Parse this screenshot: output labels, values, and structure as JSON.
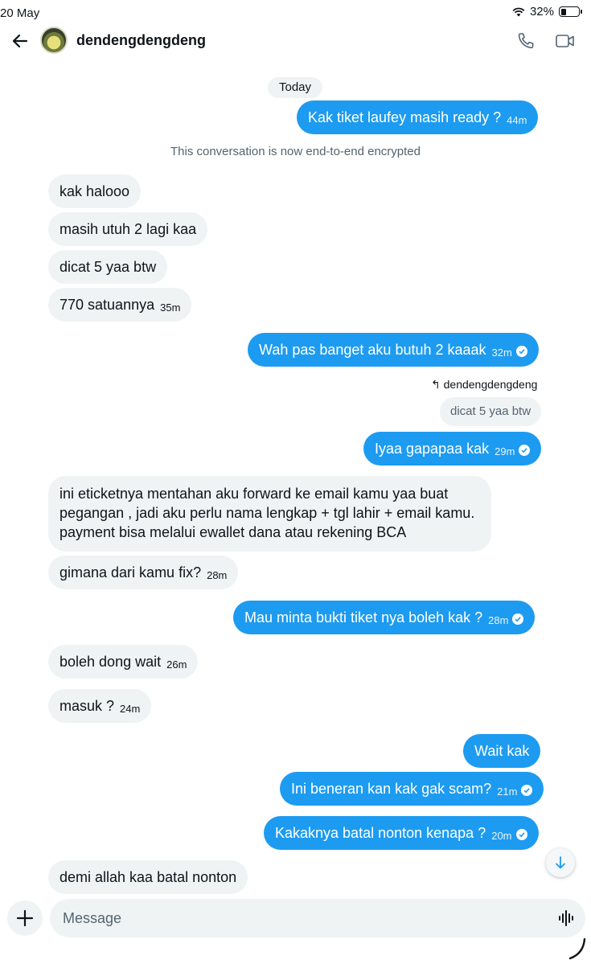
{
  "status_bar": {
    "date": "20 May",
    "battery": "32%"
  },
  "header": {
    "contact_name": "dendengdengdeng"
  },
  "chat": {
    "date_divider": "Today",
    "system_notice": "This conversation is now end-to-end encrypted",
    "messages": [
      {
        "dir": "out",
        "text": "Kak tiket laufey masih ready ?",
        "time": "44m"
      },
      {
        "dir": "in",
        "text": "kak halooo",
        "time": ""
      },
      {
        "dir": "in",
        "text": "masih utuh 2 lagi kaa",
        "time": ""
      },
      {
        "dir": "in",
        "text": "dicat 5 yaa btw",
        "time": ""
      },
      {
        "dir": "in",
        "text": "770 satuannya",
        "time": "35m"
      },
      {
        "dir": "out",
        "text": "Wah pas banget aku butuh 2 kaaak",
        "time": "32m",
        "read": true
      },
      {
        "dir": "out",
        "text": "Iyaa gapapaa kak",
        "time": "29m",
        "read": true,
        "reply_to_user": "dendengdengdeng",
        "reply_to_text": "dicat 5 yaa btw"
      },
      {
        "dir": "in",
        "lines": [
          "ini eticketnya mentahan aku forward ke email kamu yaa buat",
          "pegangan , jadi aku perlu nama lengkap + tgl lahir + email kamu.",
          "payment bisa melalui ewallet dana atau rekening BCA"
        ]
      },
      {
        "dir": "in",
        "text": "gimana dari kamu fix?",
        "time": "28m"
      },
      {
        "dir": "out",
        "text": "Mau minta bukti tiket nya boleh kak ?",
        "time": "28m",
        "read": true
      },
      {
        "dir": "in",
        "text": "boleh dong wait",
        "time": "26m"
      },
      {
        "dir": "in",
        "text": "masuk ?",
        "time": "24m"
      },
      {
        "dir": "out",
        "text": "Wait kak",
        "time": ""
      },
      {
        "dir": "out",
        "text": "Ini beneran kan kak gak scam?",
        "time": "21m",
        "read": true
      },
      {
        "dir": "out",
        "text": "Kakaknya batal nonton kenapa ?",
        "time": "20m",
        "read": true
      },
      {
        "dir": "in",
        "text": "demi allah kaa batal nonton",
        "time": ""
      }
    ]
  },
  "composer": {
    "placeholder": "Message"
  },
  "colors": {
    "accent": "#1d9bf0",
    "incoming_bubble": "#eff3f4",
    "muted_text": "#536471"
  },
  "icons": [
    "back-arrow-icon",
    "phone-icon",
    "video-icon",
    "check-circle-icon",
    "scroll-down-icon",
    "plus-icon",
    "voice-icon",
    "reply-icon",
    "wifi-icon",
    "battery-icon"
  ]
}
